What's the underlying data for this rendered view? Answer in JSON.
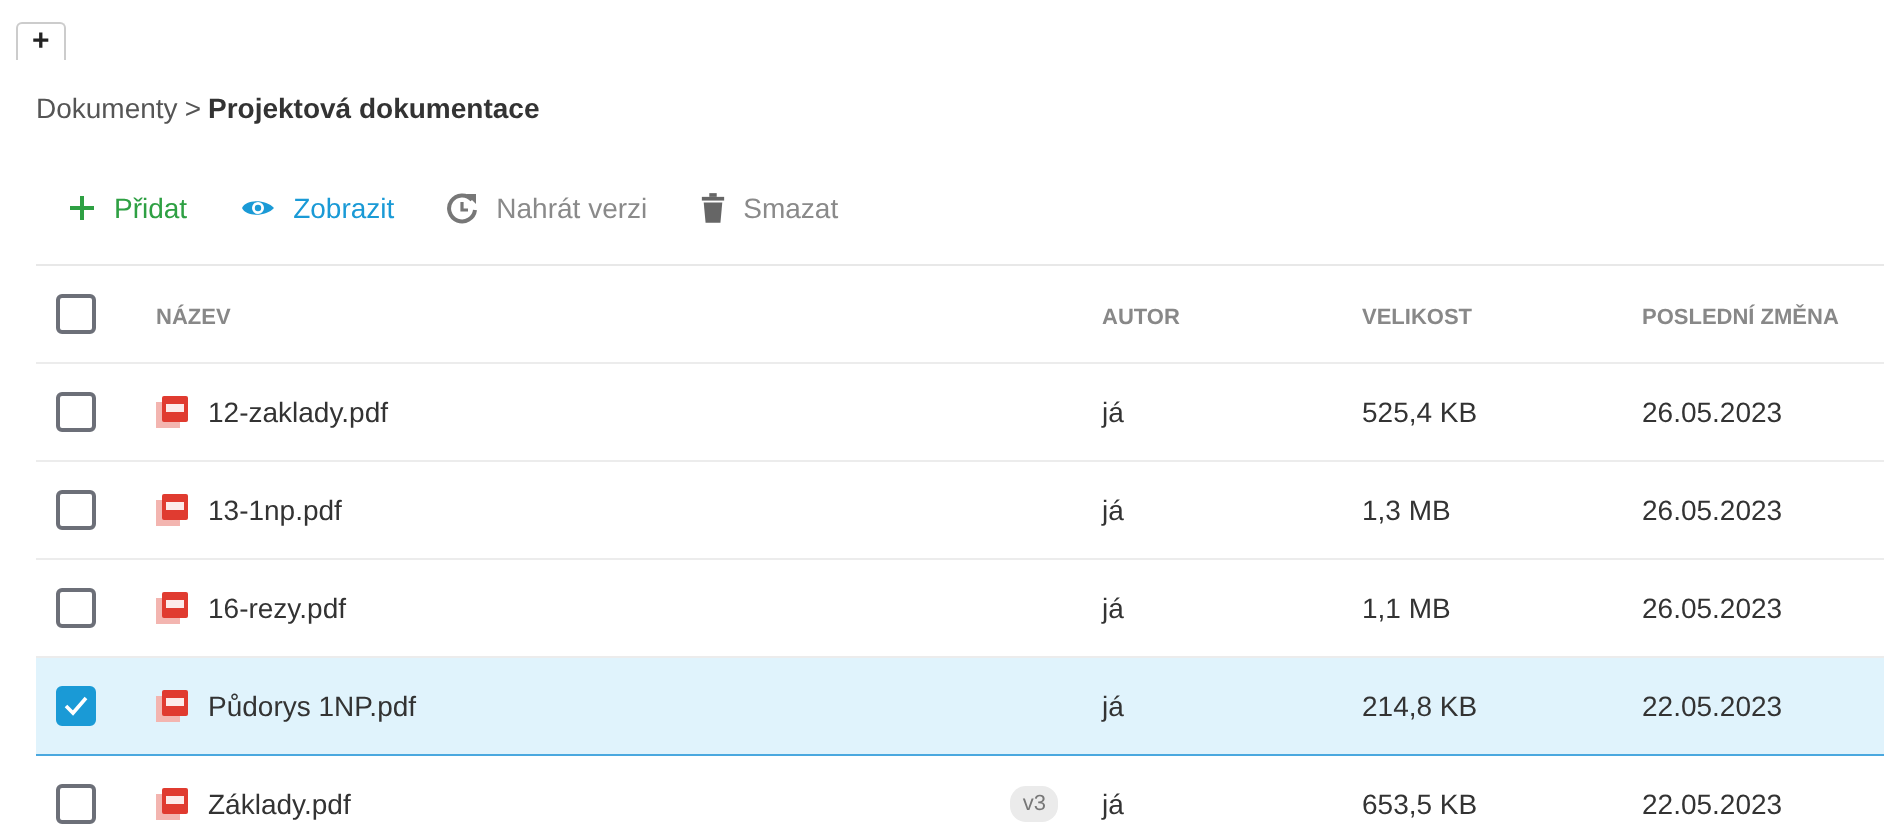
{
  "tabs": [
    {
      "label": "+",
      "selected": true
    }
  ],
  "breadcrumb": [
    {
      "label": "Dokumenty",
      "current": false
    },
    {
      "label": "Projektová dokumentace",
      "current": true
    }
  ],
  "breadcrumb_separator": ">",
  "toolbar": [
    {
      "kind": "add",
      "label": "Přidat",
      "disabled": false
    },
    {
      "kind": "view",
      "label": "Zobrazit",
      "disabled": false
    },
    {
      "kind": "upload",
      "label": "Nahrát verzi",
      "disabled": true
    },
    {
      "kind": "delete",
      "label": "Smazat",
      "disabled": true
    }
  ],
  "table": {
    "select_all": {
      "checked": false
    },
    "columns": [
      "NÁZEV",
      "AUTOR",
      "VELIKOST",
      "POSLEDNÍ ZMĚNA"
    ],
    "rows": [
      {
        "checked": false,
        "selected": false,
        "name": "12-zaklady.pdf",
        "author": "já",
        "size": "525,4 KB",
        "modified": "26.05.2023"
      },
      {
        "checked": false,
        "selected": false,
        "name": "13-1np.pdf",
        "author": "já",
        "size": "1,3 MB",
        "modified": "26.05.2023"
      },
      {
        "checked": false,
        "selected": false,
        "name": "16-rezy.pdf",
        "author": "já",
        "size": "1,1 MB",
        "modified": "26.05.2023"
      },
      {
        "checked": true,
        "selected": true,
        "name": "Půdorys 1NP.pdf",
        "author": "já",
        "size": "214,8 KB",
        "modified": "22.05.2023"
      },
      {
        "checked": false,
        "selected": false,
        "name": "Základy.pdf",
        "version": "v3",
        "author": "já",
        "size": "653,5 KB",
        "modified": "22.05.2023"
      }
    ]
  }
}
